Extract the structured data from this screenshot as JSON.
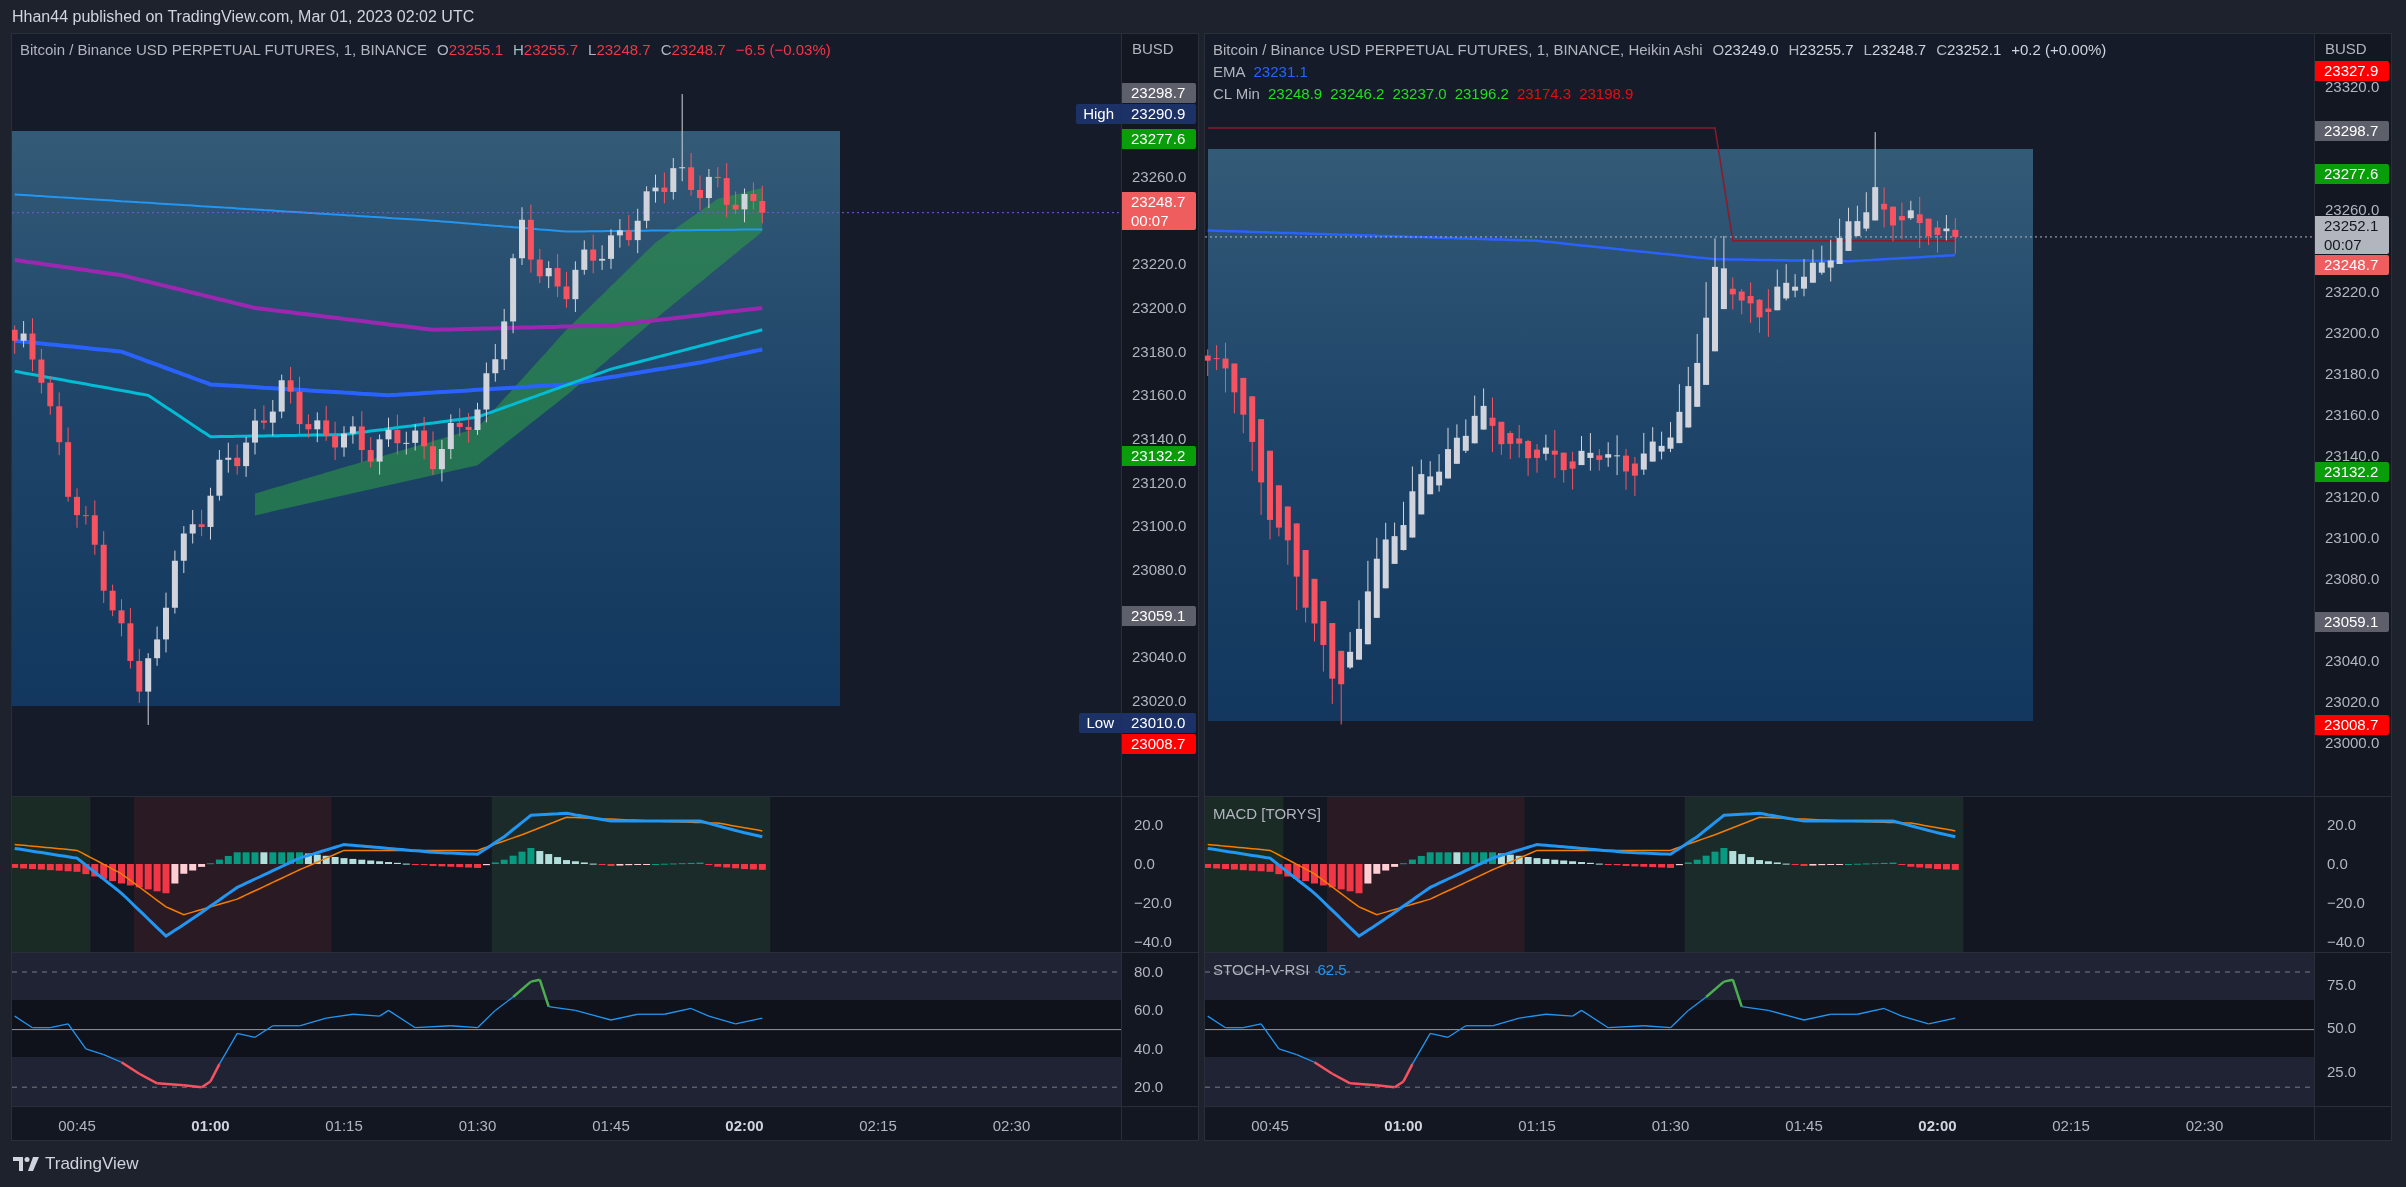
{
  "header": {
    "text": "Hhan44 published on TradingView.com, Mar 01, 2023 02:02 UTC"
  },
  "panels": [
    {
      "kind": "candles",
      "legend": {
        "title": "Bitcoin / Binance USD PERPETUAL FUTURES, 1, BINANCE",
        "ohlc": [
          {
            "key": "O",
            "value": "23255.1",
            "color": "#f23645"
          },
          {
            "key": "H",
            "value": "23255.7",
            "color": "#f23645"
          },
          {
            "key": "L",
            "value": "23248.7",
            "color": "#f23645"
          },
          {
            "key": "C",
            "value": "23248.7",
            "color": "#f23645"
          }
        ],
        "change": {
          "text": "−6.5 (−0.03%)",
          "color": "#f23645"
        }
      },
      "price_axis": {
        "currency": "BUSD",
        "ticks": [
          "23260.0",
          "23220.0",
          "23200.0",
          "23180.0",
          "23160.0",
          "23140.0",
          "23120.0",
          "23100.0",
          "23080.0",
          "23040.0",
          "23020.0"
        ],
        "markers": [
          {
            "value": "23298.7",
            "color": "#5d606b"
          },
          {
            "value": "23290.9",
            "tag": "High",
            "color": "#1c3166"
          },
          {
            "value": "23277.6",
            "color": "#0a9d0a"
          },
          {
            "value": "23248.7",
            "sub": "00:07",
            "color": "#f05d5e"
          },
          {
            "value": "23132.2",
            "color": "#0a9d0a"
          },
          {
            "value": "23059.1",
            "color": "#5d606b"
          },
          {
            "value": "23010.0",
            "tag": "Low",
            "color": "#1c3166"
          },
          {
            "value": "23008.7",
            "color": "#ff0000"
          }
        ]
      },
      "macd_axis": [
        "20.0",
        "0.0",
        "−20.0",
        "−40.0"
      ],
      "rsi_axis": [
        "80.0",
        "60.0",
        "40.0",
        "20.0"
      ],
      "time_labels": [
        {
          "text": "00:45",
          "bold": false
        },
        {
          "text": "01:00",
          "bold": true
        },
        {
          "text": "01:15",
          "bold": false
        },
        {
          "text": "01:30",
          "bold": false
        },
        {
          "text": "01:45",
          "bold": false
        },
        {
          "text": "02:00",
          "bold": true
        },
        {
          "text": "02:15",
          "bold": false
        },
        {
          "text": "02:30",
          "bold": false
        }
      ]
    },
    {
      "kind": "heikin_ashi",
      "legend": {
        "title": "Bitcoin / Binance USD PERPETUAL FUTURES, 1, BINANCE, Heikin Ashi",
        "ohlc": [
          {
            "key": "O",
            "value": "23249.0",
            "color": "#d1d4dc"
          },
          {
            "key": "H",
            "value": "23255.7",
            "color": "#d1d4dc"
          },
          {
            "key": "L",
            "value": "23248.7",
            "color": "#d1d4dc"
          },
          {
            "key": "C",
            "value": "23252.1",
            "color": "#d1d4dc"
          }
        ],
        "change": {
          "text": "+0.2 (+0.00%)",
          "color": "#d1d4dc"
        },
        "ema": {
          "label": "EMA",
          "value": "23231.1"
        },
        "cl_min": {
          "label": "CL Min",
          "values": [
            {
              "text": "23248.9",
              "color": "#22dd22"
            },
            {
              "text": "23246.2",
              "color": "#22dd22"
            },
            {
              "text": "23237.0",
              "color": "#22dd22"
            },
            {
              "text": "23196.2",
              "color": "#22dd22"
            },
            {
              "text": "23174.3",
              "color": "#dd1111"
            },
            {
              "text": "23198.9",
              "color": "#dd1111"
            }
          ]
        }
      },
      "price_axis": {
        "currency": "BUSD",
        "ticks": [
          "23320.0",
          "23260.0",
          "23220.0",
          "23200.0",
          "23180.0",
          "23160.0",
          "23140.0",
          "23120.0",
          "23100.0",
          "23080.0",
          "23040.0",
          "23020.0",
          "23000.0"
        ],
        "markers": [
          {
            "value": "23327.9",
            "color": "#ff0000"
          },
          {
            "value": "23298.7",
            "color": "#5d606b"
          },
          {
            "value": "23277.6",
            "color": "#0a9d0a"
          },
          {
            "value": "23252.1",
            "sub": "00:07",
            "color": "#b2b5be"
          },
          {
            "value": "23248.7",
            "color": "#f05d5e"
          },
          {
            "value": "23132.2",
            "color": "#0a9d0a"
          },
          {
            "value": "23059.1",
            "color": "#5d606b"
          },
          {
            "value": "23008.7",
            "color": "#ff0000"
          }
        ]
      },
      "macd_label": "MACD [TORYS]",
      "macd_axis": [
        "20.0",
        "0.0",
        "−20.0",
        "−40.0"
      ],
      "rsi_label": {
        "name": "STOCH-V-RSI",
        "value": "62.5"
      },
      "rsi_axis": [
        "75.0",
        "50.0",
        "25.0"
      ],
      "time_labels": [
        {
          "text": "00:45",
          "bold": false
        },
        {
          "text": "01:00",
          "bold": true
        },
        {
          "text": "01:15",
          "bold": false
        },
        {
          "text": "01:30",
          "bold": false
        },
        {
          "text": "01:45",
          "bold": false
        },
        {
          "text": "02:00",
          "bold": true
        },
        {
          "text": "02:15",
          "bold": false
        },
        {
          "text": "02:30",
          "bold": false
        }
      ]
    }
  ],
  "footer": {
    "brand": "TradingView"
  }
}
